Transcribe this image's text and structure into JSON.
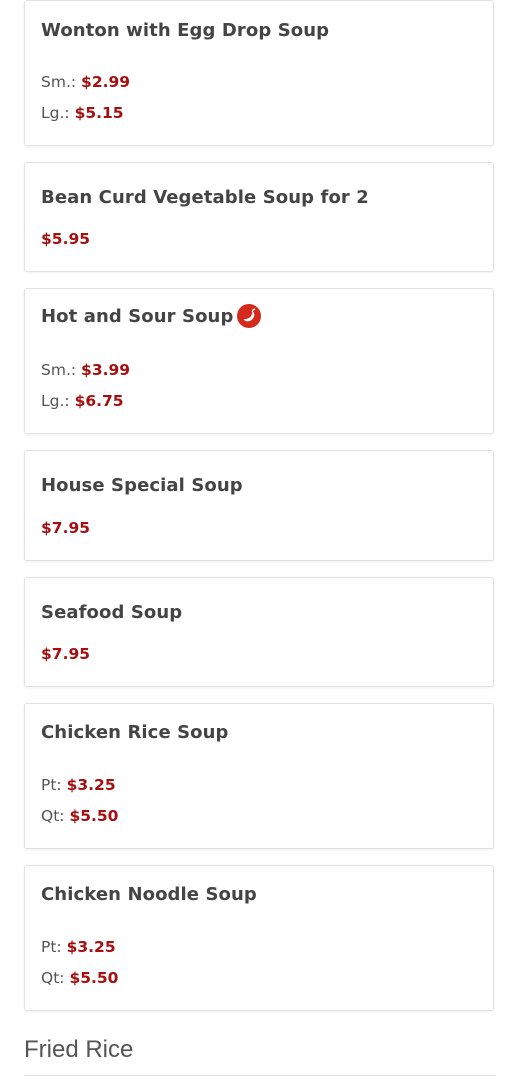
{
  "items": [
    {
      "name": "Wonton with Egg Drop Soup",
      "prices": [
        {
          "size": "Sm.:",
          "amount": "$2.99"
        },
        {
          "size": "Lg.:",
          "amount": "$5.15"
        }
      ]
    },
    {
      "name": "Bean Curd Vegetable Soup for 2",
      "prices": [
        {
          "size": "",
          "amount": "$5.95"
        }
      ]
    },
    {
      "name": "Hot and Sour Soup",
      "spicy_icon": "chili-pepper-icon",
      "prices": [
        {
          "size": "Sm.:",
          "amount": "$3.99"
        },
        {
          "size": "Lg.:",
          "amount": "$6.75"
        }
      ]
    },
    {
      "name": "House Special Soup",
      "prices": [
        {
          "size": "",
          "amount": "$7.95"
        }
      ]
    },
    {
      "name": "Seafood Soup",
      "prices": [
        {
          "size": "",
          "amount": "$7.95"
        }
      ]
    },
    {
      "name": "Chicken Rice Soup",
      "prices": [
        {
          "size": "Pt:",
          "amount": "$3.25"
        },
        {
          "size": "Qt:",
          "amount": "$5.50"
        }
      ]
    },
    {
      "name": "Chicken Noodle Soup",
      "prices": [
        {
          "size": "Pt:",
          "amount": "$3.25"
        },
        {
          "size": "Qt:",
          "amount": "$5.50"
        }
      ]
    }
  ],
  "next_section": {
    "title": "Fried Rice"
  },
  "colors": {
    "price": "#a50f0f",
    "name": "#444444",
    "label": "#555555",
    "border": "#e2e2e2",
    "spicy_icon": "#d42a1e"
  }
}
